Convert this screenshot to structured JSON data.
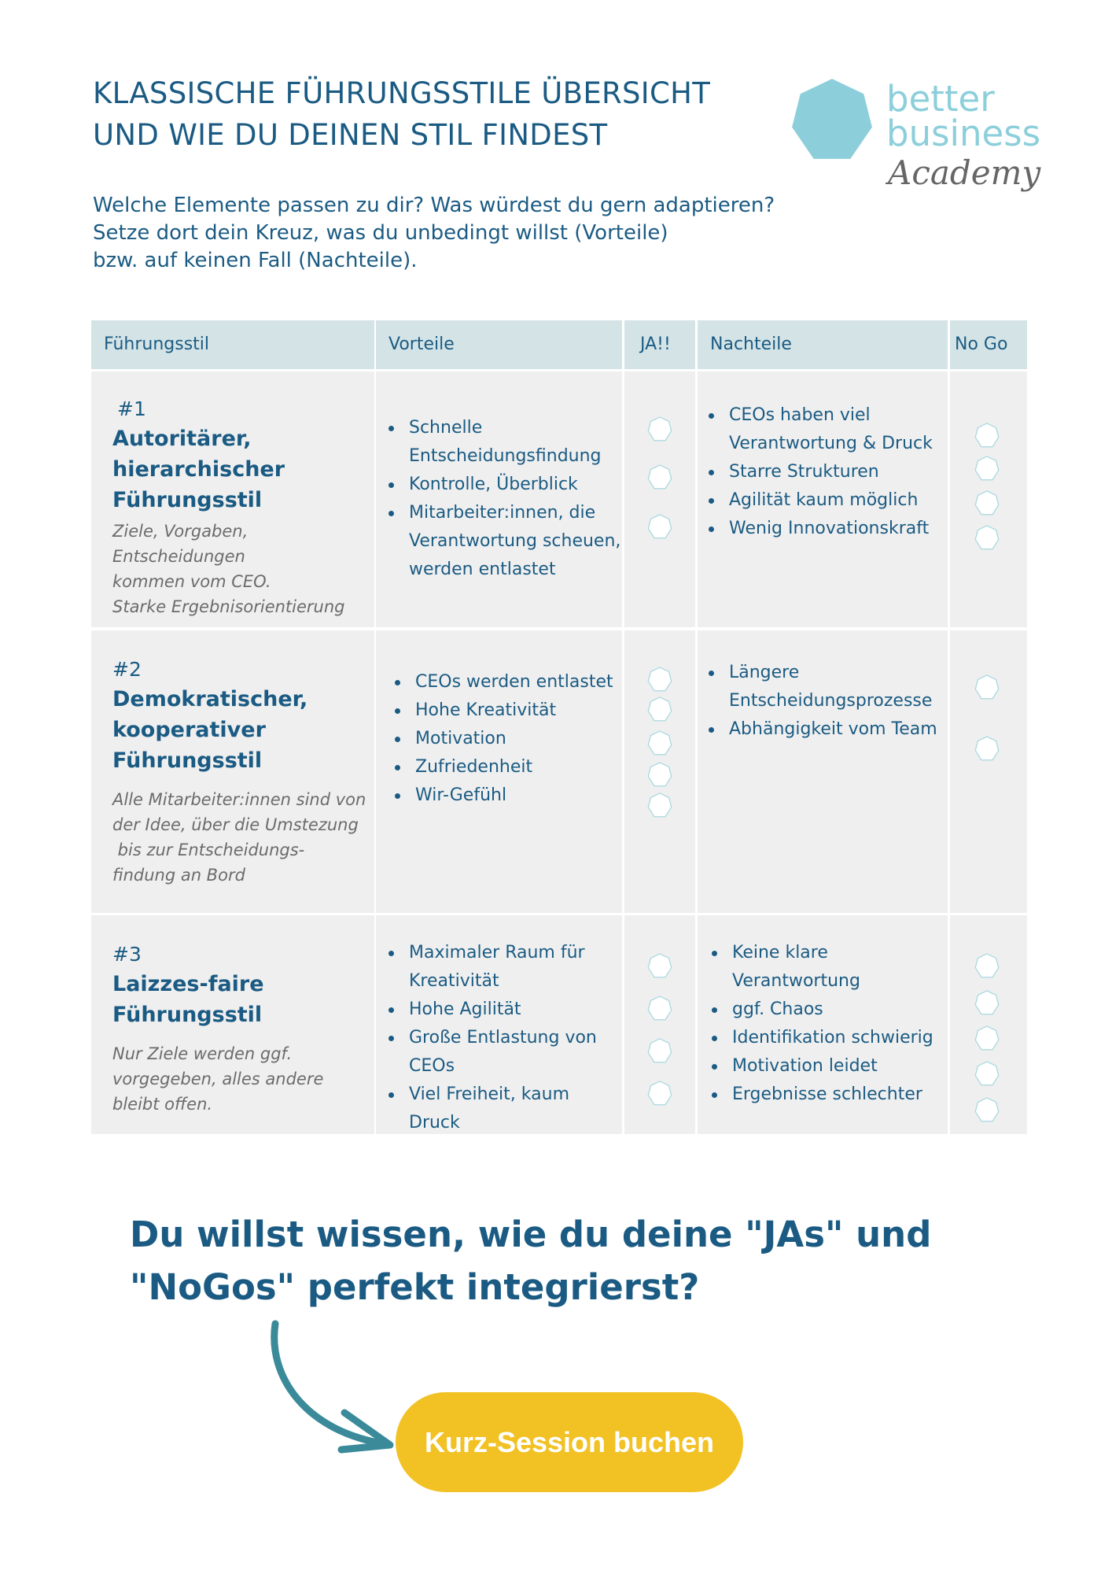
{
  "title": {
    "line1": "KLASSISCHE FÜHRUNGSSTILE ÜBERSICHT",
    "line2": "UND WIE DU DEINEN STIL FINDEST"
  },
  "logo": {
    "line1": "better",
    "line2": "business",
    "line3": "Academy",
    "color": "#8ccfdb"
  },
  "intro": [
    "Welche Elemente passen zu dir? Was würdest du gern adaptieren?",
    "Setze dort dein Kreuz, was du unbedingt willst (Vorteile)",
    "bzw. auf keinen Fall (Nachteile)."
  ],
  "table": {
    "headers": {
      "style": "Führungsstil",
      "pros": "Vorteile",
      "yes": "JA!!",
      "cons": "Nachteile",
      "nogo": "No Go"
    },
    "rows": [
      {
        "number": "#1",
        "title": [
          "Autoritärer,",
          "hierarchischer",
          "Führungsstil"
        ],
        "description": [
          "Ziele, Vorgaben,",
          "Entscheidungen",
          "kommen vom CEO.",
          "Starke Ergebnisorientierung"
        ],
        "pros": [
          "Schnelle Entscheidungsfindung",
          "Kontrolle, Überblick",
          "Mitarbeiter:innen, die Verantwortung scheuen, werden entlastet"
        ],
        "cons": [
          "CEOs haben viel Verantwortung & Druck",
          "Starre Strukturen",
          "Agilität kaum möglich",
          "Wenig Innovationskraft"
        ]
      },
      {
        "number": "#2",
        "title": [
          "Demokratischer,",
          "kooperativer",
          "Führungsstil"
        ],
        "description": [
          "Alle Mitarbeiter:innen sind von",
          "der Idee, über die Umstezung",
          " bis zur Entscheidungs-",
          "findung an Bord"
        ],
        "pros": [
          "CEOs werden entlastet",
          "Hohe Kreativität",
          "Motivation",
          "Zufriedenheit",
          "Wir-Gefühl"
        ],
        "cons": [
          "Längere Entscheidungsprozesse",
          "Abhängigkeit vom Team"
        ]
      },
      {
        "number": "#3",
        "title": [
          "Laizzes-faire",
          "Führungsstil"
        ],
        "description": [
          "Nur Ziele werden ggf.",
          "vorgegeben, alles andere",
          "bleibt offen."
        ],
        "pros": [
          "Maximaler Raum für Kreativität",
          "Hohe Agilität",
          "Große Entlastung von CEOs",
          "Viel Freiheit, kaum Druck"
        ],
        "cons": [
          "Keine klare Verantwortung",
          "ggf. Chaos",
          "Identifikation schwierig",
          "Motivation leidet",
          "Ergebnisse schlechter"
        ]
      }
    ]
  },
  "cta": {
    "headline_line1": "Du willst wissen, wie du deine \"JAs\" und",
    "headline_line2": "\"NoGos\" perfekt integrierst?",
    "button_label": "Kurz-Session buchen",
    "button_color": "#f2c123",
    "arrow_color": "#3a8a9a"
  },
  "colors": {
    "text": "#1b5b83",
    "header_bg": "#d4e4e6",
    "cell_bg": "#efefef",
    "checkbox_outline": "#a8d8e0"
  }
}
